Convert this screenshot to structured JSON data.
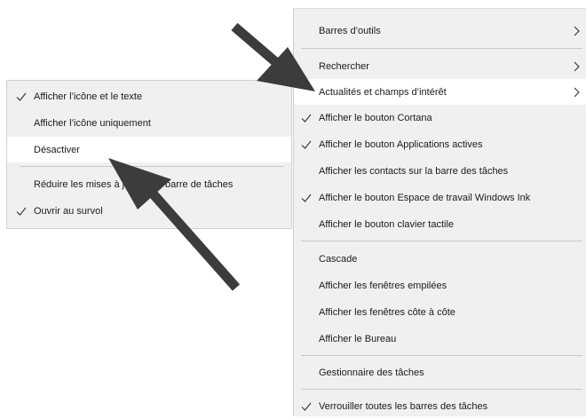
{
  "taskbar_menu": {
    "items": [
      {
        "label": "Barres d’outils"
      },
      {
        "label": "Rechercher"
      },
      {
        "label": "Actualités et champs d’intérêt"
      },
      {
        "label": "Afficher le bouton Cortana"
      },
      {
        "label": "Afficher le bouton Applications actives"
      },
      {
        "label": "Afficher les contacts sur la barre des tâches"
      },
      {
        "label": "Afficher le bouton Espace de travail Windows Ink"
      },
      {
        "label": "Afficher le bouton clavier tactile"
      },
      {
        "label": "Cascade"
      },
      {
        "label": "Afficher les fenêtres empilées"
      },
      {
        "label": "Afficher les fenêtres côte à côte"
      },
      {
        "label": "Afficher le Bureau"
      },
      {
        "label": "Gestionnaire des tâches"
      },
      {
        "label": "Verrouiller toutes les barres des tâches"
      }
    ]
  },
  "news_submenu": {
    "items": [
      {
        "label": "Afficher l’icône et le texte"
      },
      {
        "label": "Afficher l’icône uniquement"
      },
      {
        "label": "Désactiver"
      },
      {
        "label": "Réduire les mises à jour de la barre de tâches"
      },
      {
        "label": "Ouvrir au survol"
      }
    ]
  },
  "colors": {
    "menu_bg": "#f0f0f0",
    "highlight_bg": "#ffffff",
    "arrow": "#3c3c3c"
  },
  "icons": [
    "check-icon",
    "chevron-right-icon",
    "arrow-pointer"
  ]
}
